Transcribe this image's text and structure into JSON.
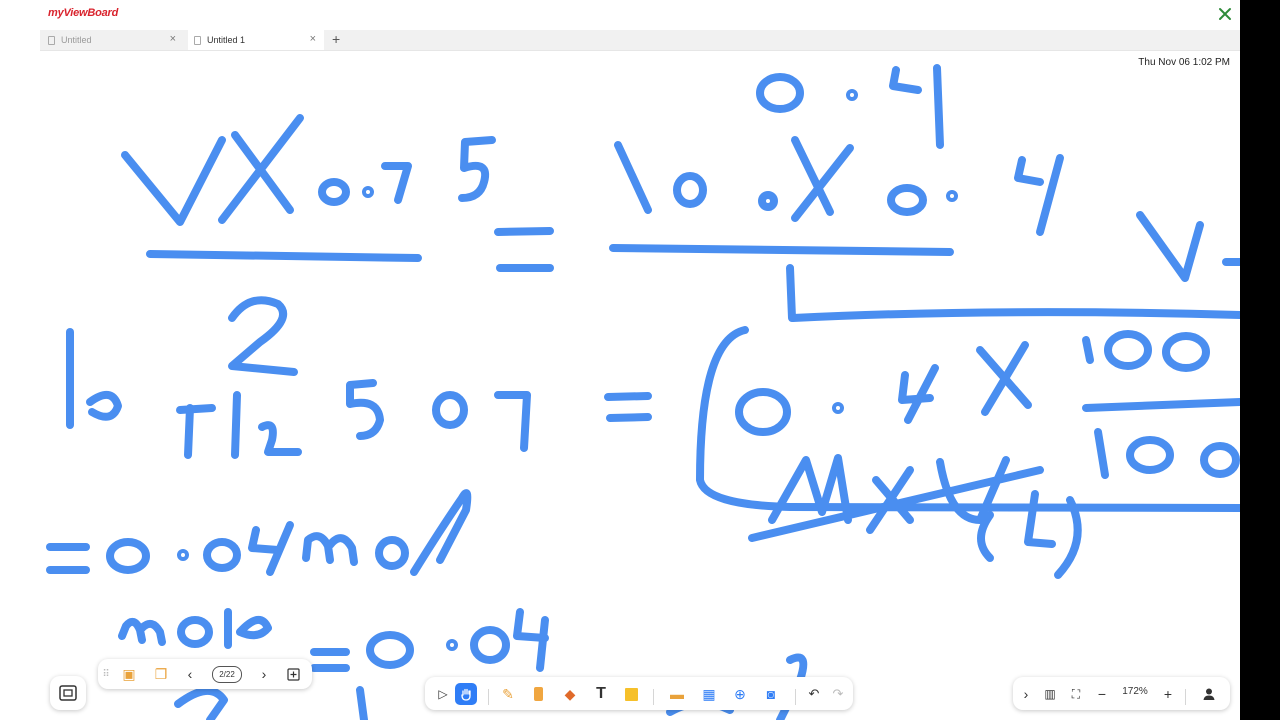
{
  "app": {
    "logo_text": "myViewBoard"
  },
  "tabs": [
    {
      "label": "Untitled",
      "active": false
    },
    {
      "label": "Untitled 1",
      "active": true
    }
  ],
  "datetime": "Thu Nov 06 1:02 PM",
  "page_nav": {
    "indicator": "2/22"
  },
  "zoom": {
    "level": "172%"
  },
  "colors": {
    "ink": "#4a8ef0",
    "brand": "#d9232d",
    "accent": "#2f7df6"
  }
}
